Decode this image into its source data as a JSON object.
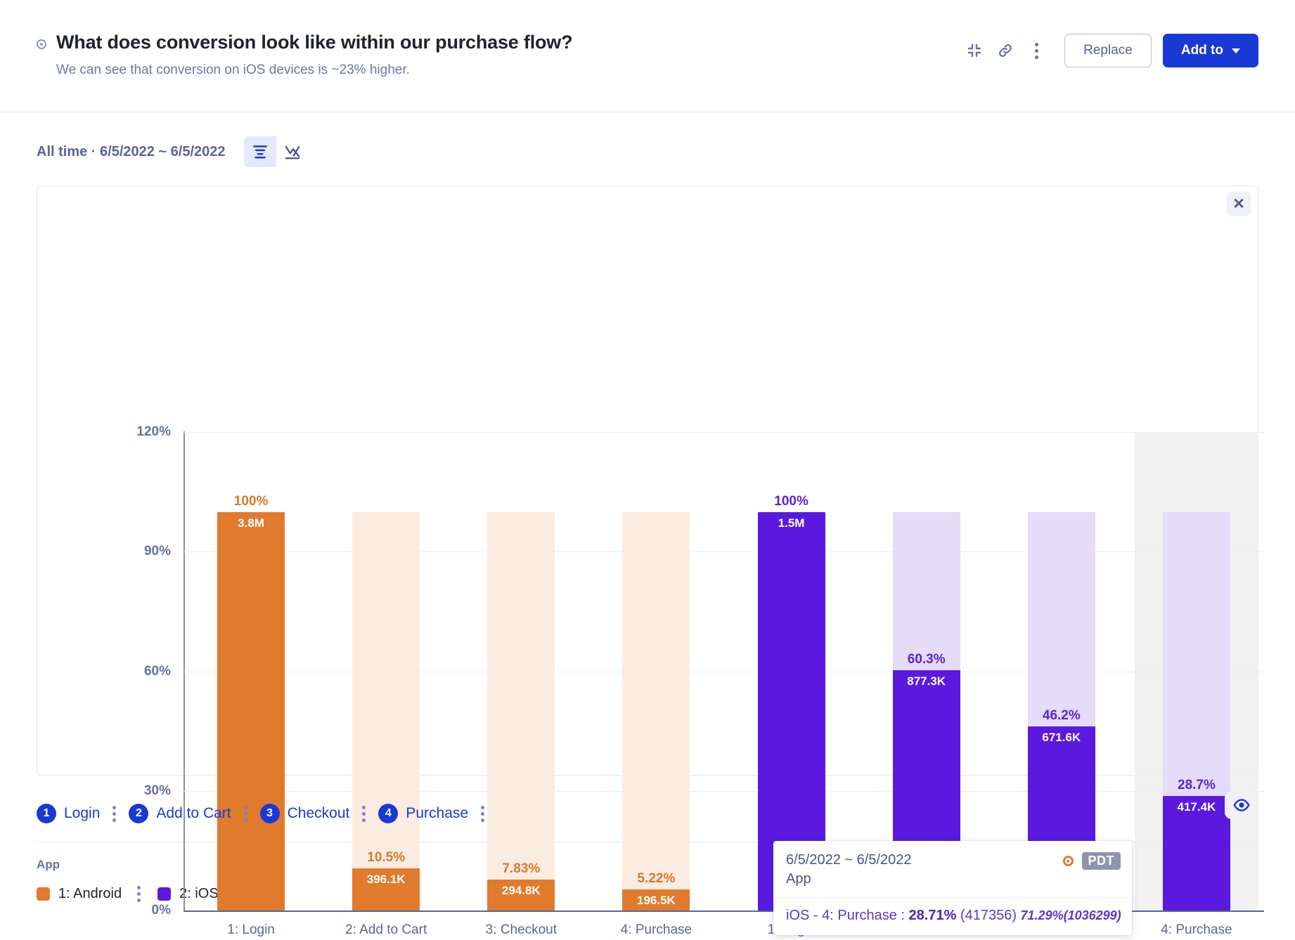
{
  "header": {
    "title": "What does conversion look like within our purchase flow?",
    "subtitle": "We can see that conversion on iOS devices is ~23% higher.",
    "actions": {
      "collapse_icon": "collapse-icon",
      "link_icon": "link-icon",
      "more_icon": "kebab-menu-icon",
      "replace_label": "Replace",
      "add_to_label": "Add to"
    }
  },
  "toolbar": {
    "date_range": "All time · 6/5/2022 ~ 6/5/2022",
    "funnel_view_icon": "funnel-chart-icon",
    "trend_view_icon": "trend-chart-icon",
    "active_view": "funnel"
  },
  "chart_card": {
    "close_label": "✕"
  },
  "chart_data": {
    "type": "bar",
    "title": "",
    "xlabel": "",
    "ylabel": "",
    "ylim": [
      0,
      120
    ],
    "yticks": [
      "0%",
      "30%",
      "60%",
      "90%",
      "120%"
    ],
    "ytick_values": [
      0,
      30,
      60,
      90,
      120
    ],
    "grid": true,
    "legend_position": "bottom",
    "categories": [
      "1: Login",
      "2: Add to Cart",
      "3: Checkout",
      "4: Purchase"
    ],
    "groups": [
      {
        "name": "1: Android",
        "color": "#e07b2e",
        "ghost_color": "#fbece1",
        "labels_color": "#d9772c",
        "bars": [
          {
            "category": "1: Login",
            "pct": 100,
            "pct_label": "100%",
            "value_label": "3.8M"
          },
          {
            "category": "2: Add to Cart",
            "pct": 10.5,
            "pct_label": "10.5%",
            "value_label": "396.1K"
          },
          {
            "category": "3: Checkout",
            "pct": 7.83,
            "pct_label": "7.83%",
            "value_label": "294.8K"
          },
          {
            "category": "4: Purchase",
            "pct": 5.22,
            "pct_label": "5.22%",
            "value_label": "196.5K"
          }
        ]
      },
      {
        "name": "2: iOS",
        "color": "#5b19e0",
        "ghost_color": "#e4dcf8",
        "labels_color": "#5b22d6",
        "bars": [
          {
            "category": "1: Login",
            "pct": 100,
            "pct_label": "100%",
            "value_label": "1.5M"
          },
          {
            "category": "2: Add to Cart",
            "pct": 60.3,
            "pct_label": "60.3%",
            "value_label": "877.3K"
          },
          {
            "category": "3: Checkout",
            "pct": 46.2,
            "pct_label": "46.2%",
            "value_label": "671.6K"
          },
          {
            "category": "4: Purchase",
            "pct": 28.7,
            "pct_label": "28.7%",
            "value_label": "417.4K"
          }
        ]
      }
    ],
    "hover_highlight": {
      "group": "2: iOS",
      "category": "4: Purchase"
    }
  },
  "tooltip": {
    "date": "6/5/2022 ~ 6/5/2022",
    "scope": "App",
    "timezone_badge": "PDT",
    "status_icon": "record-dot-icon",
    "series": "iOS - 4: Purchase : ",
    "primary_pct": "28.71%",
    "primary_count": " (417356) ",
    "secondary": "71.29%(1036299)"
  },
  "steps": [
    {
      "num": "1",
      "label": "Login"
    },
    {
      "num": "2",
      "label": "Add to Cart"
    },
    {
      "num": "3",
      "label": "Checkout"
    },
    {
      "num": "4",
      "label": "Purchase"
    }
  ],
  "steps_eye_icon": "eye-icon",
  "legend": {
    "title": "App",
    "items": [
      {
        "label": "1: Android",
        "color": "#e07b2e"
      },
      {
        "label": "2: iOS",
        "color": "#5b19e0"
      }
    ]
  }
}
